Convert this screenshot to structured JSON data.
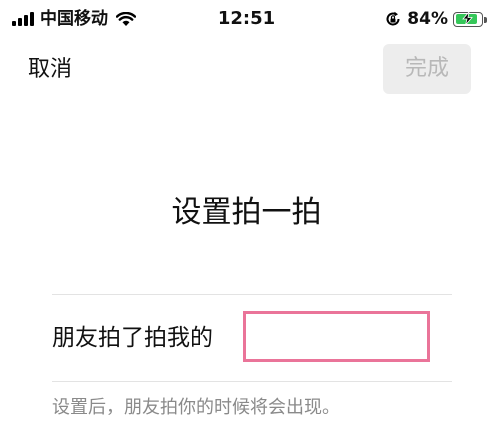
{
  "status_bar": {
    "carrier": "中国移动",
    "time": "12:51",
    "battery_percent": "84%",
    "battery_level": 0.84,
    "icons": [
      "signal-icon",
      "wifi-icon",
      "orientation-lock-icon",
      "battery-charging-icon"
    ]
  },
  "nav": {
    "cancel_label": "取消",
    "done_label": "完成"
  },
  "page": {
    "title": "设置拍一拍"
  },
  "pat": {
    "prefix": "朋友拍了拍我的",
    "value": "",
    "hint": "设置后，朋友拍你的时候将会出现。"
  },
  "colors": {
    "input_border": "#ea7499",
    "battery": "#35c759",
    "hint_text": "#8a8a8a",
    "done_bg": "#ededed",
    "done_text": "#b8b8b8"
  }
}
